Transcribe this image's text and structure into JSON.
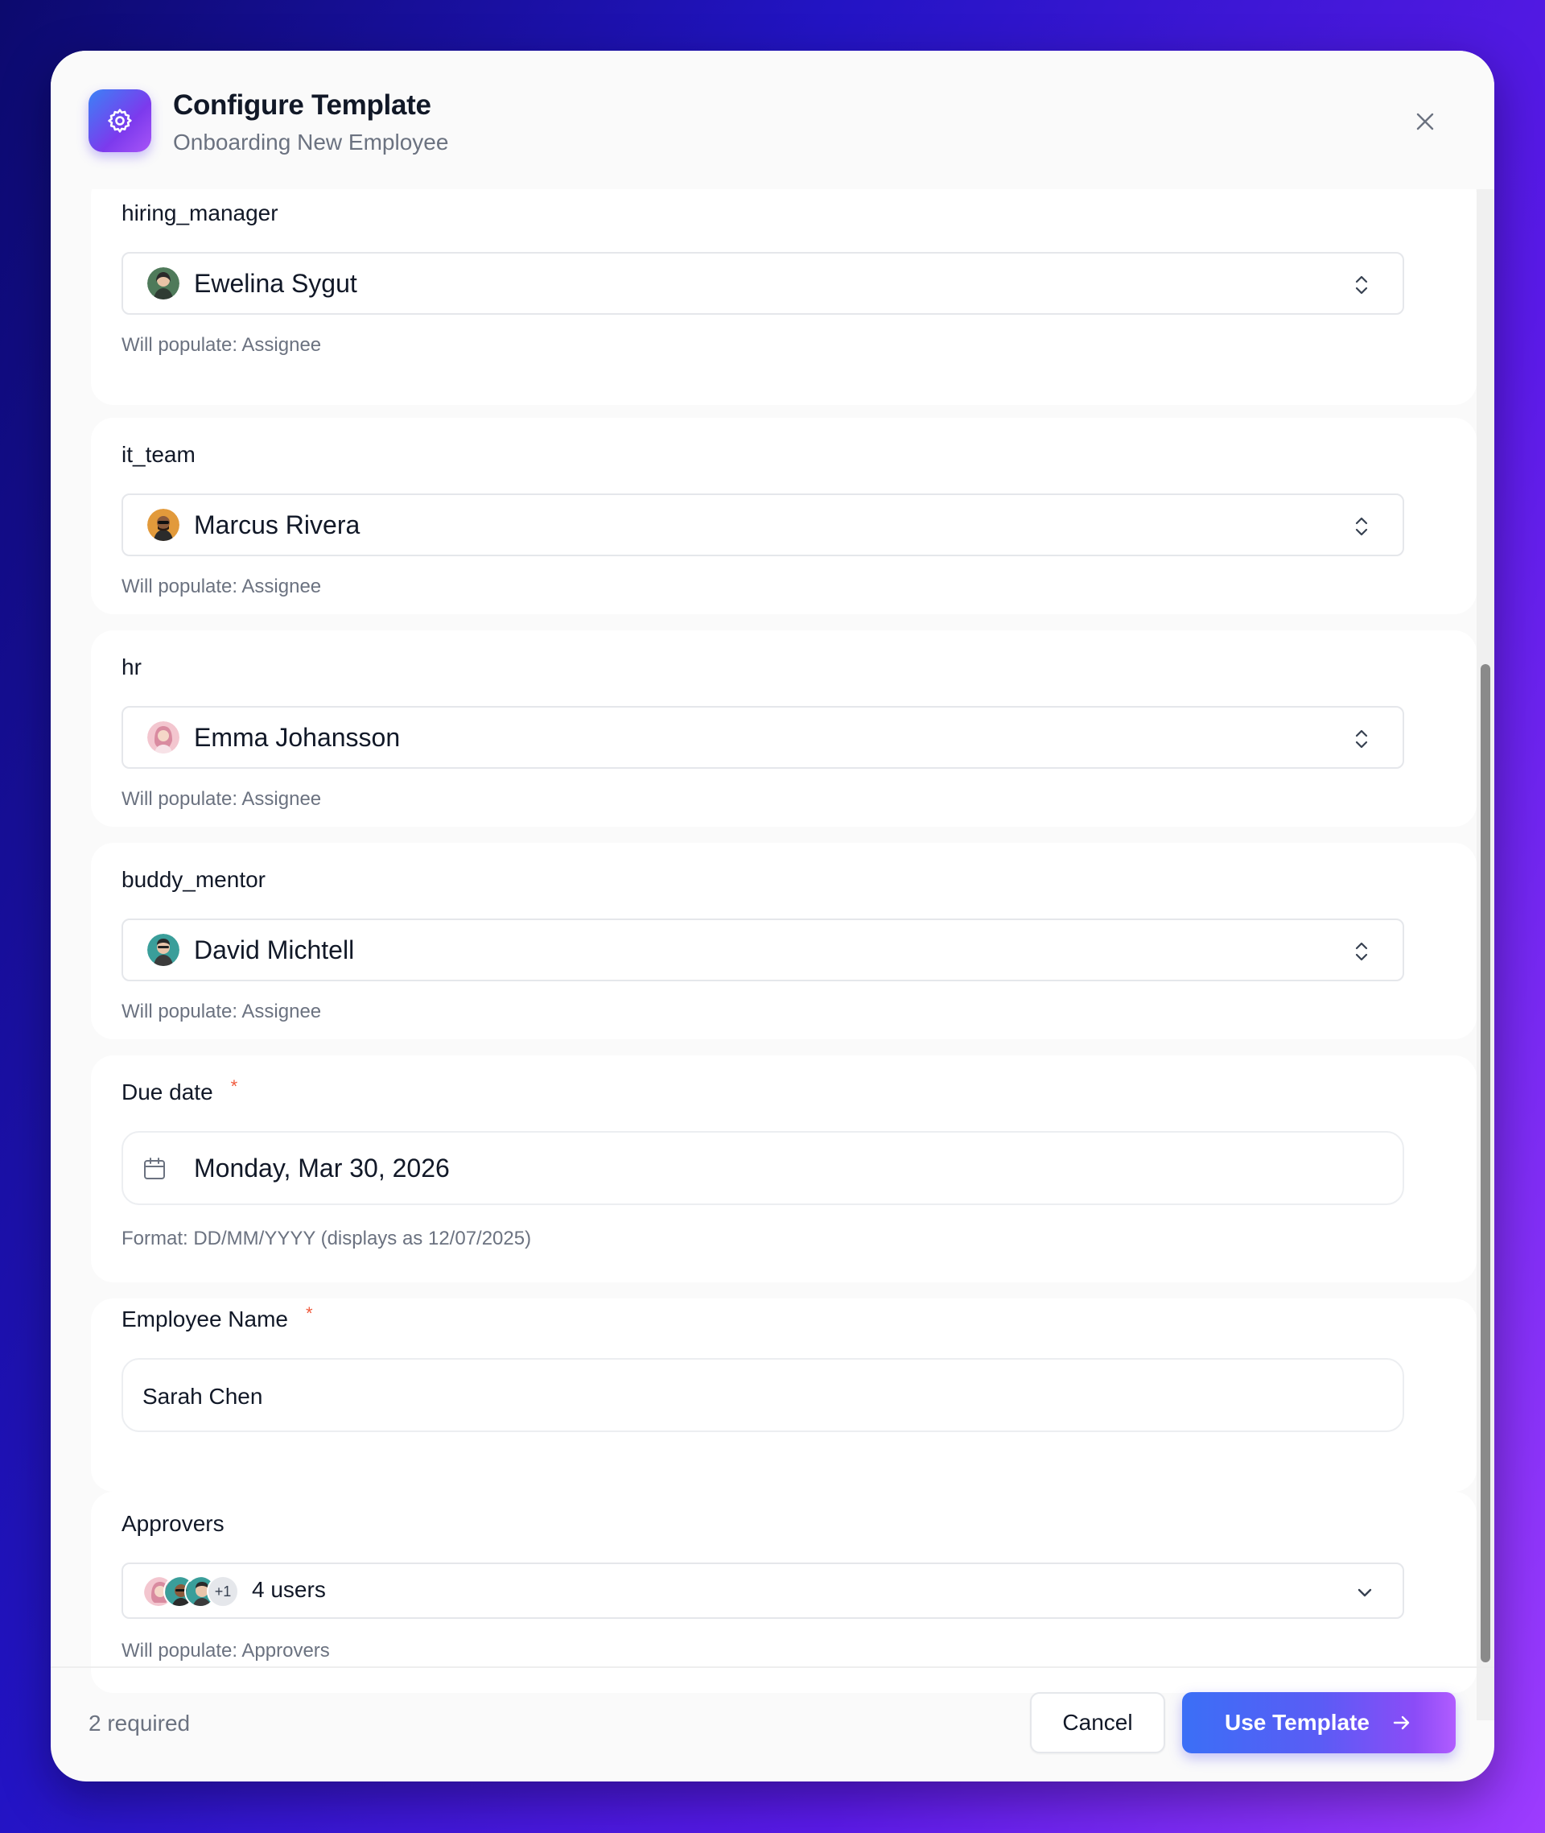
{
  "header": {
    "title": "Configure Template",
    "subtitle": "Onboarding New Employee"
  },
  "icons": {
    "app": "gear-icon",
    "close": "close-icon",
    "select": "chevron-up-down-icon",
    "date": "calendar-icon",
    "dropdown": "chevron-down-icon",
    "submit": "arrow-right-icon"
  },
  "fields": {
    "hiring_manager": {
      "label": "hiring_manager",
      "value": "Ewelina Sygut",
      "helper": "Will populate: Assignee"
    },
    "it_team": {
      "label": "it_team",
      "value": "Marcus Rivera",
      "helper": "Will populate: Assignee"
    },
    "hr": {
      "label": "hr",
      "value": "Emma Johansson",
      "helper": "Will populate: Assignee"
    },
    "buddy_mentor": {
      "label": "buddy_mentor",
      "value": "David Michtell",
      "helper": "Will populate: Assignee"
    },
    "due_date": {
      "label": "Due date",
      "required_mark": "*",
      "value": "Monday, Mar 30, 2026",
      "helper": "Format: DD/MM/YYYY (displays as 12/07/2025)"
    },
    "employee_name": {
      "label": "Employee Name",
      "required_mark": "*",
      "value": "Sarah Chen"
    },
    "approvers": {
      "label": "Approvers",
      "overflow_count": "+1",
      "value": "4 users",
      "helper": "Will populate: Approvers"
    }
  },
  "footer": {
    "required_count": "2 required",
    "cancel_label": "Cancel",
    "submit_label": "Use Template"
  },
  "colors": {
    "accent_start": "#3b6ff6",
    "accent_end": "#b15cff",
    "required": "#f05a3c"
  }
}
